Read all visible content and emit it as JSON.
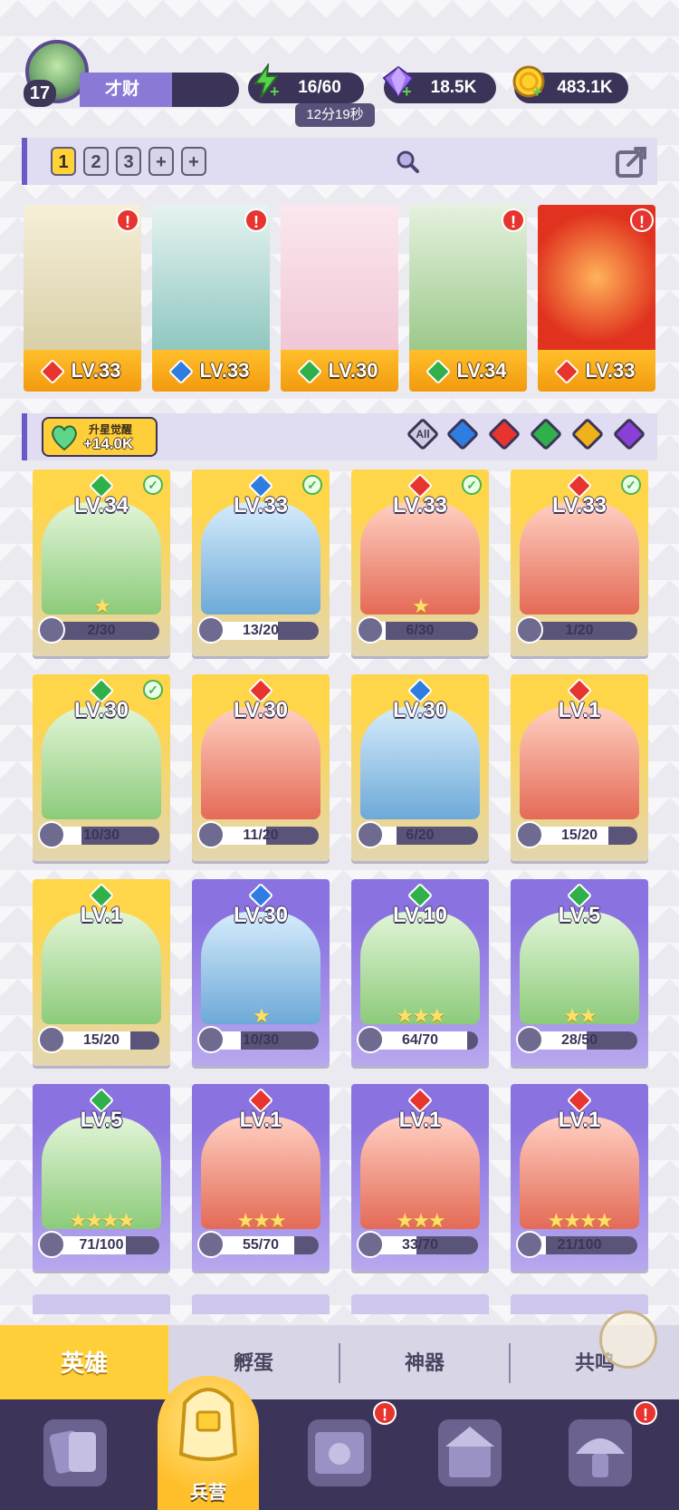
{
  "header": {
    "level": "17",
    "player_name": "才财",
    "energy": "16/60",
    "energy_timer": "12分19秒",
    "gems": "18.5K",
    "gold": "483.1K"
  },
  "teams": {
    "tabs": [
      "1",
      "2",
      "3",
      "+",
      "+"
    ],
    "active_index": 0
  },
  "team_cards": [
    {
      "level": "LV.33",
      "element": "fire",
      "alert": true
    },
    {
      "level": "LV.33",
      "element": "water",
      "alert": true
    },
    {
      "level": "LV.30",
      "element": "wind",
      "alert": false
    },
    {
      "level": "LV.34",
      "element": "wind",
      "alert": true
    },
    {
      "level": "LV.33",
      "element": "fire",
      "alert": true
    }
  ],
  "awaken": {
    "label": "升星觉醒",
    "value": "+14.0K"
  },
  "filters": [
    "All",
    "water",
    "fire",
    "wind",
    "light",
    "dark"
  ],
  "heroes": [
    {
      "level": "LV.34",
      "element": "wind",
      "progress": "2/30",
      "fill": 0.07,
      "rarity": "gold",
      "check": true,
      "stars": 1
    },
    {
      "level": "LV.33",
      "element": "water",
      "progress": "13/20",
      "fill": 0.65,
      "rarity": "gold",
      "check": true,
      "stars": 0
    },
    {
      "level": "LV.33",
      "element": "fire",
      "progress": "6/30",
      "fill": 0.2,
      "rarity": "gold",
      "check": true,
      "stars": 1
    },
    {
      "level": "LV.33",
      "element": "fire",
      "progress": "1/20",
      "fill": 0.05,
      "rarity": "gold",
      "check": true,
      "stars": 0
    },
    {
      "level": "LV.30",
      "element": "wind",
      "progress": "10/30",
      "fill": 0.33,
      "rarity": "gold",
      "check": true,
      "stars": 0
    },
    {
      "level": "LV.30",
      "element": "fire",
      "progress": "11/20",
      "fill": 0.55,
      "rarity": "gold",
      "check": false,
      "stars": 0
    },
    {
      "level": "LV.30",
      "element": "water",
      "progress": "6/20",
      "fill": 0.3,
      "rarity": "gold",
      "check": false,
      "stars": 0
    },
    {
      "level": "LV.1",
      "element": "fire",
      "progress": "15/20",
      "fill": 0.75,
      "rarity": "gold",
      "check": false,
      "stars": 0
    },
    {
      "level": "LV.1",
      "element": "wind",
      "progress": "15/20",
      "fill": 0.75,
      "rarity": "gold",
      "check": false,
      "stars": 0
    },
    {
      "level": "LV.30",
      "element": "water",
      "progress": "10/30",
      "fill": 0.33,
      "rarity": "purple",
      "check": false,
      "stars": 1
    },
    {
      "level": "LV.10",
      "element": "wind",
      "progress": "64/70",
      "fill": 0.91,
      "rarity": "purple",
      "check": false,
      "stars": 3
    },
    {
      "level": "LV.5",
      "element": "wind",
      "progress": "28/50",
      "fill": 0.56,
      "rarity": "purple",
      "check": false,
      "stars": 2
    },
    {
      "level": "LV.5",
      "element": "wind",
      "progress": "71/100",
      "fill": 0.71,
      "rarity": "purple",
      "check": false,
      "stars": 4
    },
    {
      "level": "LV.1",
      "element": "fire",
      "progress": "55/70",
      "fill": 0.79,
      "rarity": "purple",
      "check": false,
      "stars": 3
    },
    {
      "level": "LV.1",
      "element": "fire",
      "progress": "33/70",
      "fill": 0.47,
      "rarity": "purple",
      "check": false,
      "stars": 3
    },
    {
      "level": "LV.1",
      "element": "fire",
      "progress": "21/100",
      "fill": 0.21,
      "rarity": "purple",
      "check": false,
      "stars": 4
    }
  ],
  "subtabs": [
    "英雄",
    "孵蛋",
    "神器",
    "共鸣"
  ],
  "nav": {
    "center_label": "兵营",
    "alerts": [
      false,
      false,
      true,
      false,
      true
    ]
  },
  "colors": {
    "fire": "#e8342e",
    "water": "#2f7de0",
    "wind": "#2fb04a",
    "light": "#f0b21a",
    "dark": "#8a3fd6",
    "accent": "#ffcf3a",
    "panel": "#3b3458"
  }
}
